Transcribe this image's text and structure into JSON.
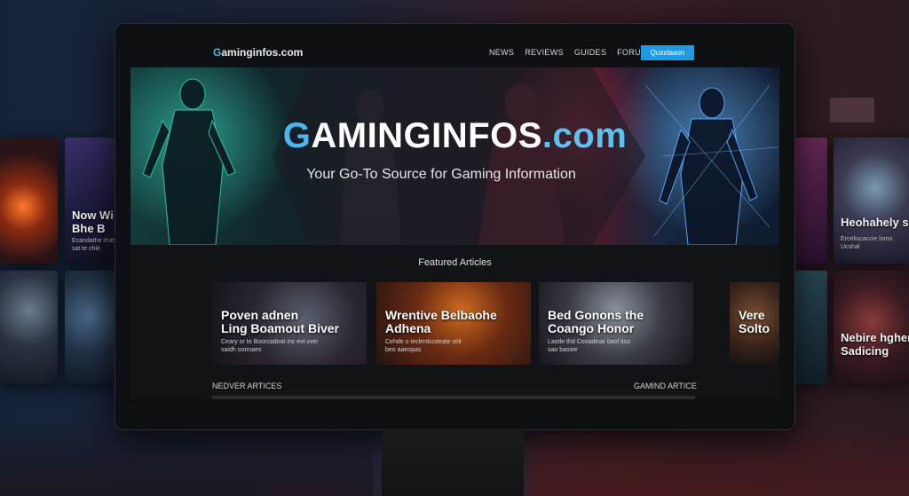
{
  "background_tiles": [
    {
      "title": "",
      "subtitle": ""
    },
    {
      "title": "Now Wi\nBhe B",
      "subtitle": "Ecandathe rrutse\nsat te chiit"
    },
    {
      "title": "",
      "subtitle": ""
    },
    {
      "title": "",
      "subtitle": ""
    },
    {
      "title": "",
      "subtitle": ""
    },
    {
      "title": "Heohahely s",
      "subtitle": "Erceliucaccie lomo\nUcshal"
    },
    {
      "title": "",
      "subtitle": ""
    },
    {
      "title": "Nebire hgher\nSadicing",
      "subtitle": ""
    }
  ],
  "site": {
    "logo_prefix": "G",
    "logo_rest": "aminginfos.com"
  },
  "nav": {
    "links": [
      "NEWS",
      "REVIEWS",
      "GUIDES",
      "FORUMS"
    ],
    "cta": "Qusstaaon"
  },
  "hero": {
    "title_g": "G",
    "title_mid": "AMINGINFOS",
    "title_com": ".com",
    "subtitle": "Your Go-To Source for Gaming Information"
  },
  "featured": {
    "heading": "Featured Articles",
    "cards": [
      {
        "title": "Poven adnen\nLing Boamout Biver",
        "subtitle": "Ceary or to Boorcadnat inc evt vvei\nsaidh oonnaes"
      },
      {
        "title": "Wrentive Belbaohe\nAdhena",
        "subtitle": "Cehde o teclentiusteate stilr\nbeo aaeopas"
      },
      {
        "title": "Bed Gonons the\nCoango Honor",
        "subtitle": "Laotle thd Cooadinar baol tiso\nsao baswe"
      },
      {
        "title": "Vere\nSolto",
        "subtitle": ""
      }
    ]
  },
  "footer_row": {
    "left": "NEDVER ARTICES",
    "right": "GAMIND ARTICE"
  },
  "colors": {
    "accent": "#1e9be3",
    "logo_accent": "#38c3f5",
    "screen_bg": "#121316"
  }
}
